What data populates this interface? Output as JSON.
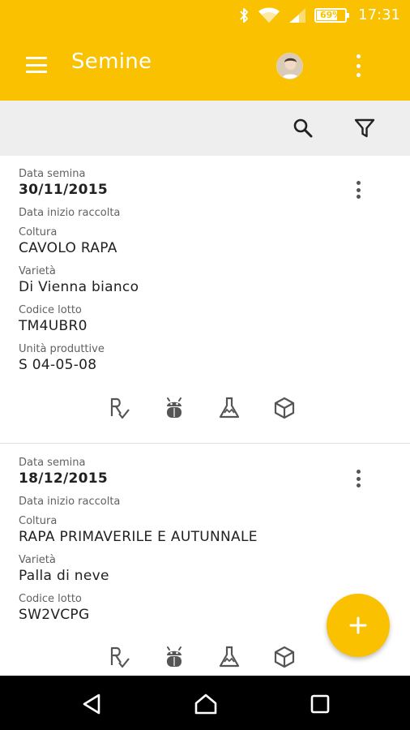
{
  "status_bar": {
    "battery": "69%",
    "time": "17:31"
  },
  "app_bar": {
    "title": "Semine",
    "avatar": "user-avatar"
  },
  "toolbar": {
    "search_icon": "search-icon",
    "filter_icon": "filter-icon"
  },
  "cards": [
    {
      "data_semina_label": "Data semina",
      "data_semina": "30/11/2015",
      "data_inizio_label": "Data inizio raccolta",
      "coltura_label": "Coltura",
      "coltura": "CAVOLO RAPA",
      "varieta_label": "Varietà",
      "varieta": "Di Vienna bianco",
      "codice_label": "Codice lotto",
      "codice": "TM4UBR0",
      "unita_label": "Unità produttive",
      "unita": "S 04-05-08"
    },
    {
      "data_semina_label": "Data semina",
      "data_semina": "18/12/2015",
      "data_inizio_label": "Data inizio raccolta",
      "coltura_label": "Coltura",
      "coltura": "RAPA PRIMAVERILE E AUTUNNALE",
      "varieta_label": "Varietà",
      "varieta": "Palla di neve",
      "codice_label": "Codice lotto",
      "codice": "SW2VCPG"
    }
  ],
  "card_actions": [
    "prescription-icon",
    "bug-icon",
    "lab-flask-icon",
    "package-icon"
  ],
  "colors": {
    "accent": "#f9c100",
    "toolbar_bg": "#eeeeee",
    "nav_bg": "#000000"
  }
}
